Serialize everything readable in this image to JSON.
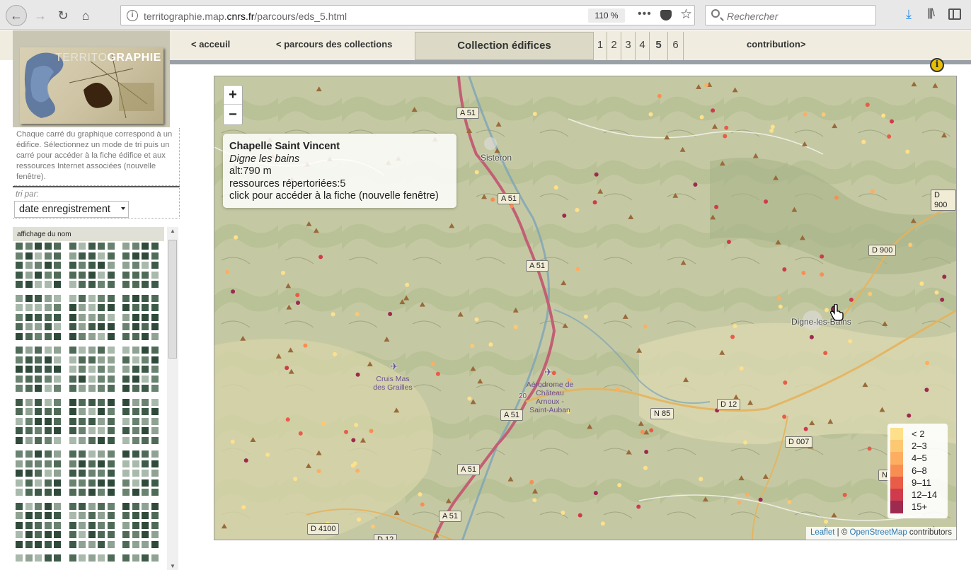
{
  "browser": {
    "url_prefix": "territographie.map.",
    "url_domain": "cnrs.fr",
    "url_path": "/parcours/eds_5.html",
    "zoom": "110 %",
    "search_placeholder": "Rechercher"
  },
  "nav": {
    "acceuil": "< acceuil",
    "parcours": "< parcours des collections",
    "collection": "Collection édifices",
    "pages": [
      "1",
      "2",
      "3",
      "4",
      "5",
      "6"
    ],
    "current_page": "5",
    "contribution": "contribution>"
  },
  "logo": {
    "text_light": "TERRITO",
    "text_bold": "GRAPHIE"
  },
  "sidebar": {
    "intro": "Chaque carré du graphique correspond à un édifice. Sélectionnez un mode de tri puis un carré pour accéder à la fiche édifice et aux ressources Internet associées (nouvelle fenêtre).",
    "sort_label": "tri par:",
    "sort_value": "date enregistrement",
    "grid_header": "affichage du nom"
  },
  "map": {
    "zoom_in": "+",
    "zoom_out": "−",
    "popup": {
      "title": "Chapelle Saint Vincent",
      "subtitle": "Digne les bains",
      "altitude": "alt:790 m",
      "resources": "ressources répertoriées:5",
      "hint": "click pour accéder à la fiche (nouvelle fenêtre)"
    },
    "labels": {
      "sisteron": "Sisteron",
      "digne": "Digne-les-Bains",
      "airport1": "Cruis Mas des Grailles",
      "airport2": "Aérodrome de Château Arnoux - Saint-Auban"
    },
    "roads": [
      "A 51",
      "A 51",
      "A 51",
      "A 51",
      "A 51",
      "A 51",
      "D 900",
      "D 900",
      "N 85",
      "D 12",
      "D 007",
      "D 4100",
      "D 12",
      "20",
      "N"
    ],
    "legend": [
      {
        "label": "< 2",
        "color": "#fee08b"
      },
      {
        "label": "2–3",
        "color": "#fdc872"
      },
      {
        "label": "4–5",
        "color": "#fdae61"
      },
      {
        "label": "6–8",
        "color": "#f98e52"
      },
      {
        "label": "9–11",
        "color": "#e95c47"
      },
      {
        "label": "12–14",
        "color": "#cf3b4d"
      },
      {
        "label": "15+",
        "color": "#9e2a50"
      }
    ],
    "attribution": {
      "leaflet": "Leaflet",
      "sep": " | © ",
      "osm": "OpenStreetMap",
      "suffix": " contributors"
    }
  }
}
